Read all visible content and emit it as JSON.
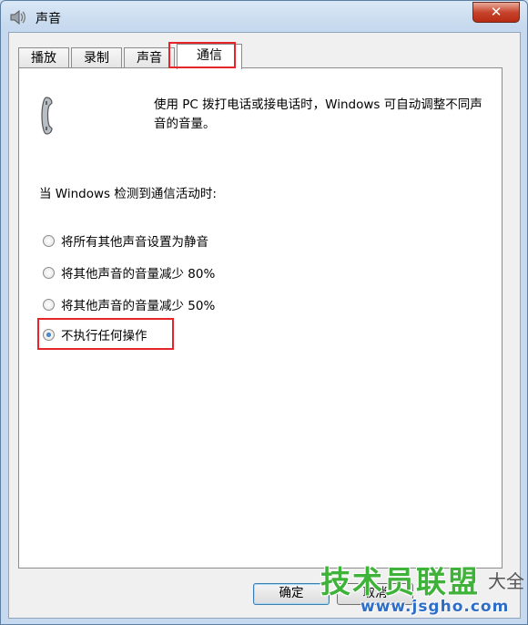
{
  "window": {
    "title": "声音"
  },
  "tabs": [
    {
      "label": "播放"
    },
    {
      "label": "录制"
    },
    {
      "label": "声音"
    },
    {
      "label": "通信"
    }
  ],
  "active_tab": "通信",
  "communications": {
    "description": "使用 PC 拨打电话或接电话时，Windows 可自动调整不同声音的音量。",
    "section_label": "当 Windows 检测到通信活动时:",
    "options": [
      {
        "label": "将所有其他声音设置为静音",
        "checked": false
      },
      {
        "label": "将其他声音的音量减少 80%",
        "checked": false
      },
      {
        "label": "将其他声音的音量减少 50%",
        "checked": false
      },
      {
        "label": "不执行任何操作",
        "checked": true
      }
    ]
  },
  "buttons": {
    "ok": "确定",
    "cancel": "取消"
  },
  "watermark": {
    "brand": "技术员联盟",
    "side": "大全",
    "url": "www.jsgho.com"
  },
  "colors": {
    "highlight": "#e8242b",
    "title_bg": "#c6d9ee",
    "close": "#c7442b"
  }
}
